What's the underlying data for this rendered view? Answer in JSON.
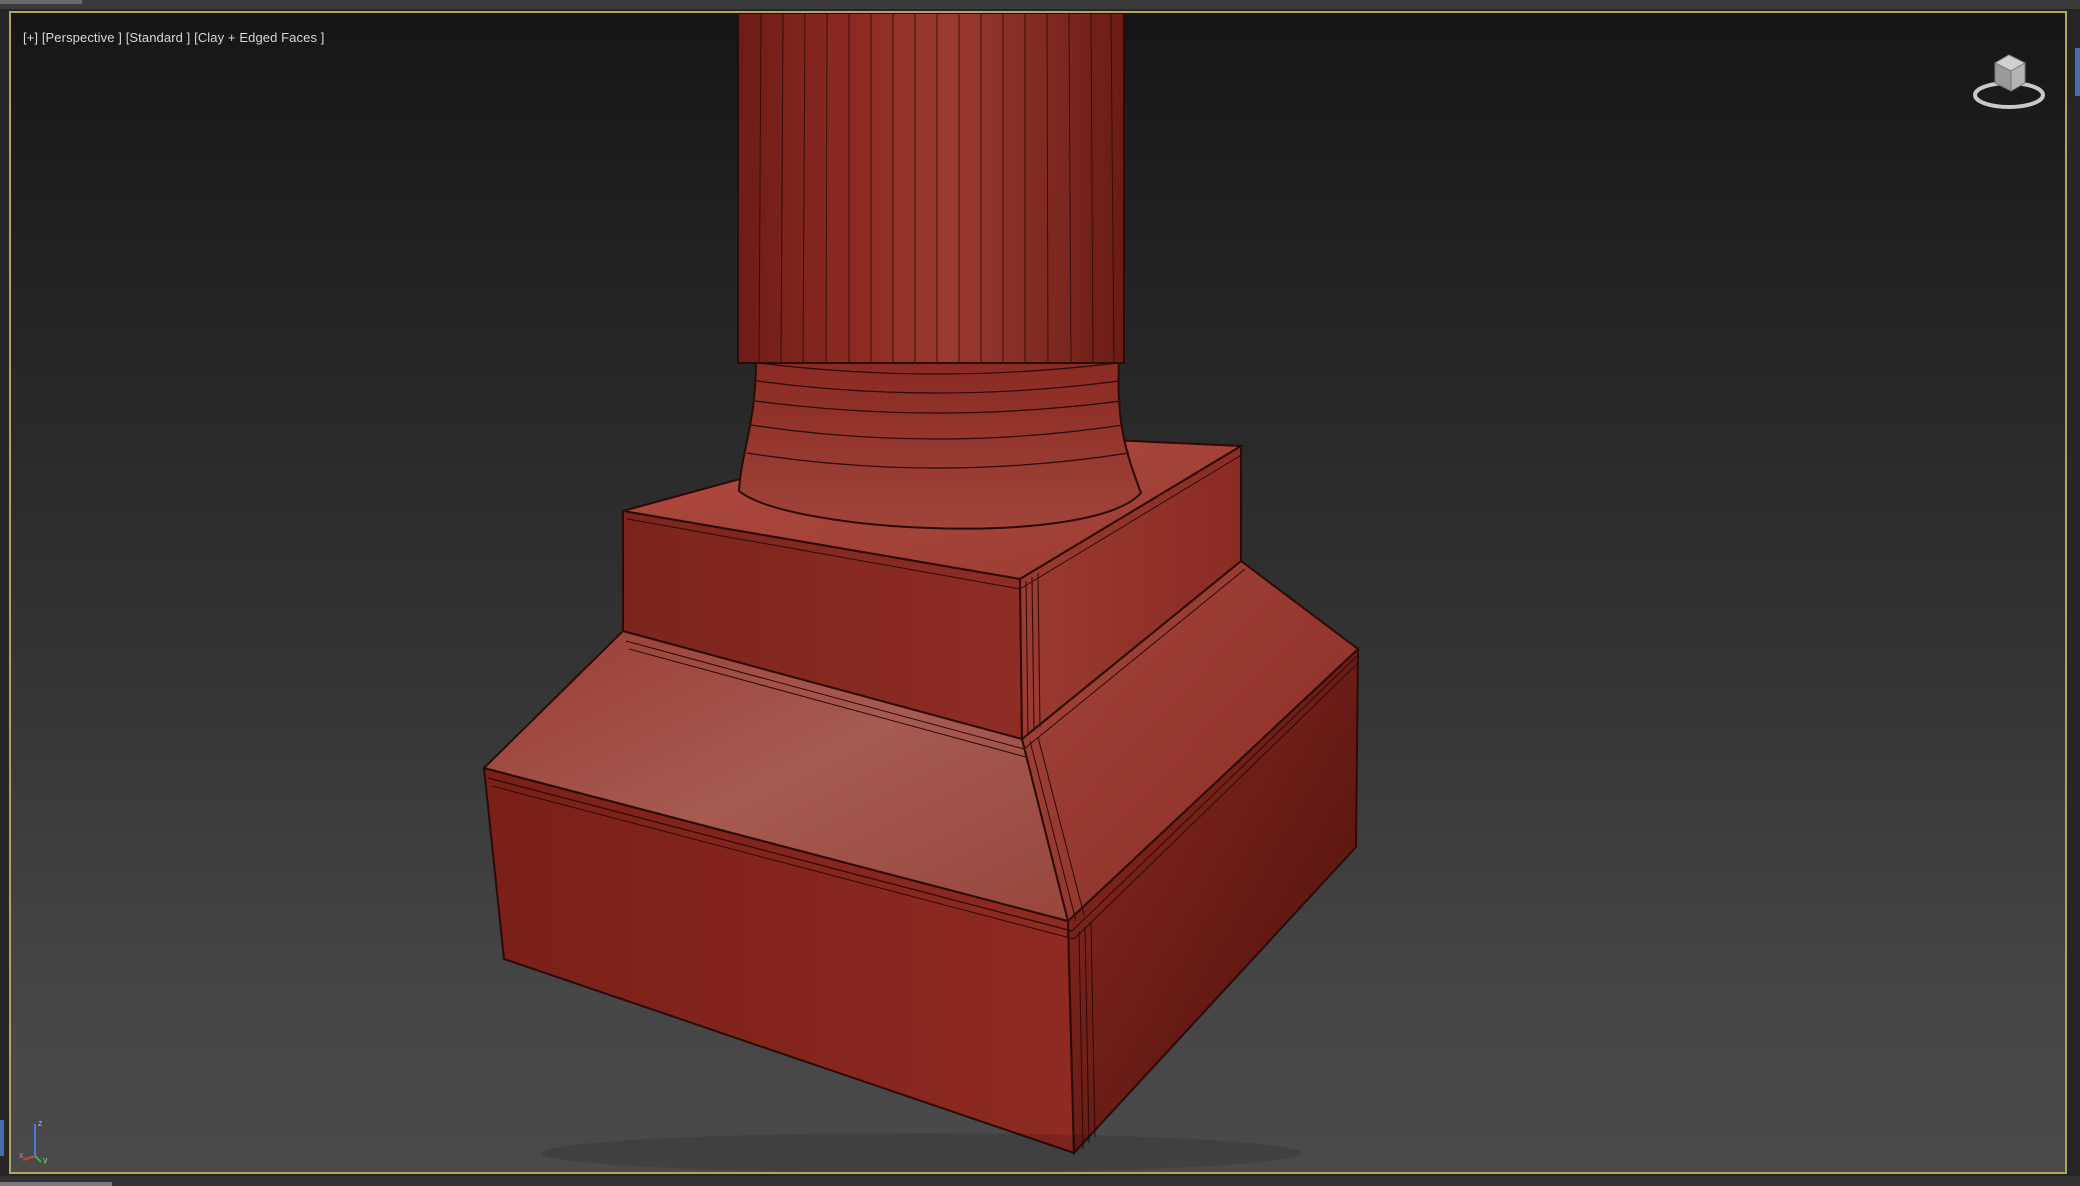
{
  "viewport": {
    "label": "[+] [Perspective ] [Standard ] [Clay + Edged Faces ]",
    "border_color": "#b4a35a",
    "object_color": "#8e2a22",
    "wire_color": "#2a0b08"
  },
  "icons": {
    "viewcube": "viewcube-icon",
    "axis": "axis-tripod-icon"
  },
  "axis_labels": {
    "z": "z",
    "x": "x",
    "y": "y"
  }
}
